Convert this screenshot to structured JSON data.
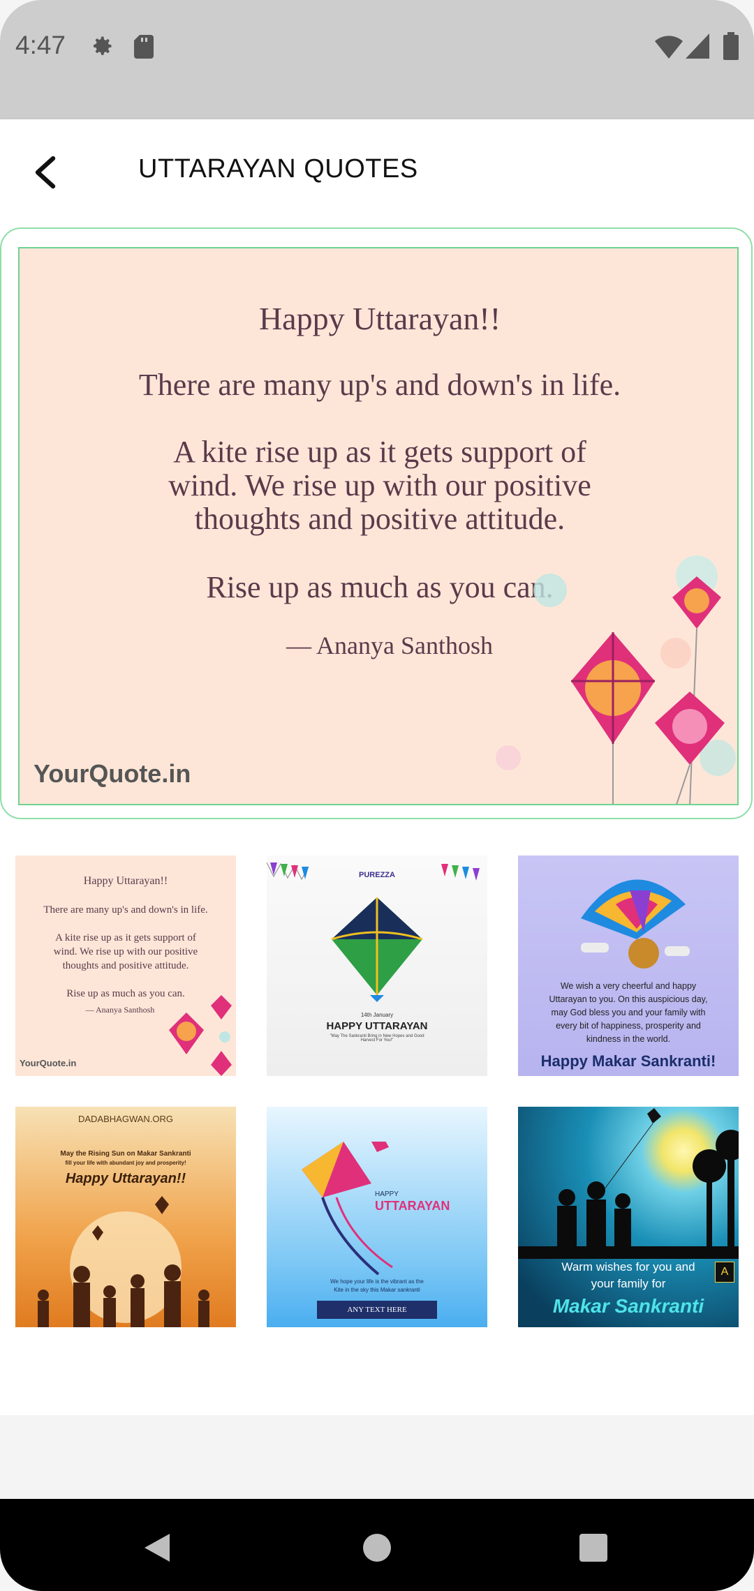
{
  "status_bar": {
    "time": "4:47",
    "icons": [
      "gear-icon",
      "sd-card-icon",
      "wifi-icon",
      "signal-icon",
      "battery-icon"
    ]
  },
  "app_bar": {
    "back_icon": "chevron-left-icon",
    "title": "UTTARAYAN QUOTES"
  },
  "featured": {
    "heading": "Happy Uttarayan!!",
    "line1": "There are many up's and down's in life.",
    "line2": "A kite rise up as it gets support of",
    "line3": "wind. We rise up with our positive",
    "line4": "thoughts and positive attitude.",
    "line5": "Rise up as much as you can.",
    "author": "— Ananya Santhosh",
    "brand": "YourQuote.in"
  },
  "thumbnails": [
    {
      "heading": "Happy Uttarayan!!",
      "line1": "There are many up's and down's in life.",
      "line2": "A kite rise up as it gets support of",
      "line3": "wind. We rise up with our positive",
      "line4": "thoughts and positive attitude.",
      "line5": "Rise up as much as you can.",
      "author": "— Ananya Santhosh",
      "brand": "YourQuote.in"
    },
    {
      "brand": "PUREZZA",
      "date": "14th January",
      "heading": "HAPPY UTTARAYAN",
      "sub": "\"May The Sankranti Bring in New Hopes and Good Harvest For You!\""
    },
    {
      "text": "We wish a very cheerful and happy Uttarayan to you. On this auspicious day, may God bless you and your family with every bit of happiness, prosperity and kindness in the world.",
      "heading": "Happy Makar Sankranti!"
    },
    {
      "site": "DADABHAGWAN.ORG",
      "line1": "May the Rising Sun on Makar Sankranti",
      "line2": "fill your life with abundant joy and prosperity!",
      "heading": "Happy Uttarayan!!"
    },
    {
      "pre": "HAPPY",
      "heading": "UTTARAYAN",
      "line1": "We hope your life is the vibrant as the",
      "line2": "Kite in the sky this Makar sankranti",
      "button": "ANY TEXT HERE"
    },
    {
      "line1": "Warm wishes for you and",
      "line2": "your family for",
      "heading": "Makar Sankranti",
      "badge": "A"
    }
  ],
  "nav": {
    "back": "triangle-back-icon",
    "home": "circle-home-icon",
    "recents": "square-recents-icon"
  },
  "colors": {
    "status_bg": "#cdcdcd",
    "accent_border": "#8fdfa8",
    "quote_bg": "#fde6d8",
    "kite_pink": "#e0307a"
  }
}
